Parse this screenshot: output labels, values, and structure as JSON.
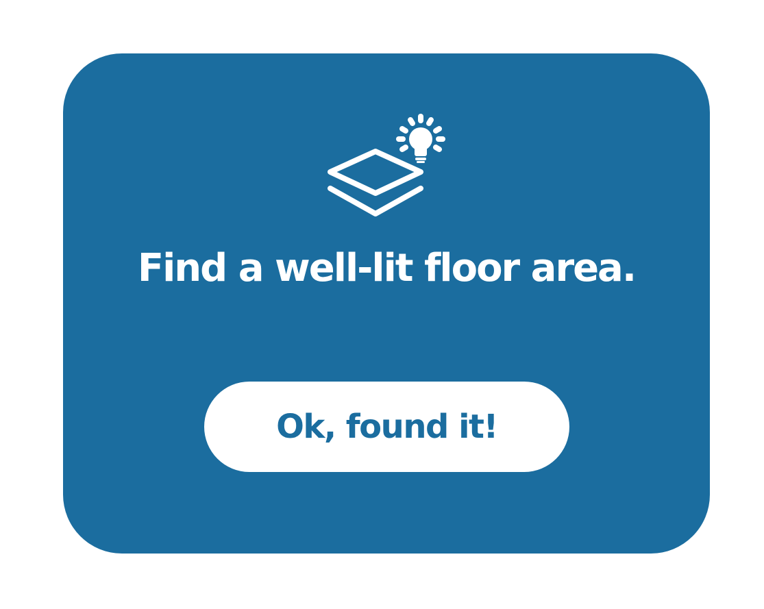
{
  "dialog": {
    "icon": "floor-layers-lightbulb-icon",
    "title": "Find a well-lit floor area.",
    "confirm_label": "Ok, found it!"
  },
  "colors": {
    "background": "#ffffff",
    "card": "#1b6d9f",
    "button": "#ffffff",
    "button_text": "#1b6d9f",
    "title_text": "#ffffff"
  }
}
